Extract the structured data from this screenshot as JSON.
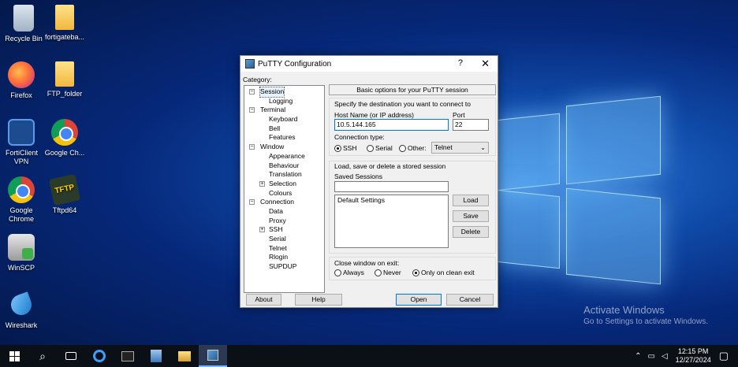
{
  "desktop": {
    "icons": [
      {
        "label": "Recycle Bin"
      },
      {
        "label": "fortigateba..."
      },
      {
        "label": "Firefox"
      },
      {
        "label": "FTP_folder"
      },
      {
        "label": "FortiClient VPN"
      },
      {
        "label": "Google Ch..."
      },
      {
        "label": "Google Chrome"
      },
      {
        "label": "Tftpd64"
      },
      {
        "label": "WinSCP"
      },
      {
        "label": "Wireshark"
      }
    ],
    "tftp_glyph": "TFTP",
    "activate_title": "Activate Windows",
    "activate_sub": "Go to Settings to activate Windows."
  },
  "putty": {
    "title": "PuTTY Configuration",
    "help_glyph": "?",
    "close_glyph": "✕",
    "category_label": "Category:",
    "tree": [
      {
        "label": "Session",
        "level": 0,
        "exp": "−",
        "selected": true
      },
      {
        "label": "Logging",
        "level": 1
      },
      {
        "label": "Terminal",
        "level": 0,
        "exp": "−"
      },
      {
        "label": "Keyboard",
        "level": 1
      },
      {
        "label": "Bell",
        "level": 1
      },
      {
        "label": "Features",
        "level": 1
      },
      {
        "label": "Window",
        "level": 0,
        "exp": "−"
      },
      {
        "label": "Appearance",
        "level": 1
      },
      {
        "label": "Behaviour",
        "level": 1
      },
      {
        "label": "Translation",
        "level": 1
      },
      {
        "label": "Selection",
        "level": 1,
        "exp": "+"
      },
      {
        "label": "Colours",
        "level": 1
      },
      {
        "label": "Connection",
        "level": 0,
        "exp": "−"
      },
      {
        "label": "Data",
        "level": 1
      },
      {
        "label": "Proxy",
        "level": 1
      },
      {
        "label": "SSH",
        "level": 1,
        "exp": "+"
      },
      {
        "label": "Serial",
        "level": 1
      },
      {
        "label": "Telnet",
        "level": 1
      },
      {
        "label": "Rlogin",
        "level": 1
      },
      {
        "label": "SUPDUP",
        "level": 1
      }
    ],
    "header": "Basic options for your PuTTY session",
    "dest_label": "Specify the destination you want to connect to",
    "host_label": "Host Name (or IP address)",
    "host_value": "10.5.144.165",
    "port_label": "Port",
    "port_value": "22",
    "conn_type_label": "Connection type:",
    "conn_types": [
      "SSH",
      "Serial",
      "Other:"
    ],
    "other_select": "Telnet",
    "sessions_group_label": "Load, save or delete a stored session",
    "saved_sessions_label": "Saved Sessions",
    "saved_sessions_value": "",
    "sessions_list": [
      "Default Settings"
    ],
    "load_label": "Load",
    "save_label": "Save",
    "delete_label": "Delete",
    "close_exit_label": "Close window on exit:",
    "close_options": [
      "Always",
      "Never",
      "Only on clean exit"
    ],
    "about_label": "About",
    "help_label": "Help",
    "open_label": "Open",
    "cancel_label": "Cancel"
  },
  "taskbar": {
    "search_glyph": "⌕",
    "time": "12:15 PM",
    "date": "12/27/2024"
  }
}
